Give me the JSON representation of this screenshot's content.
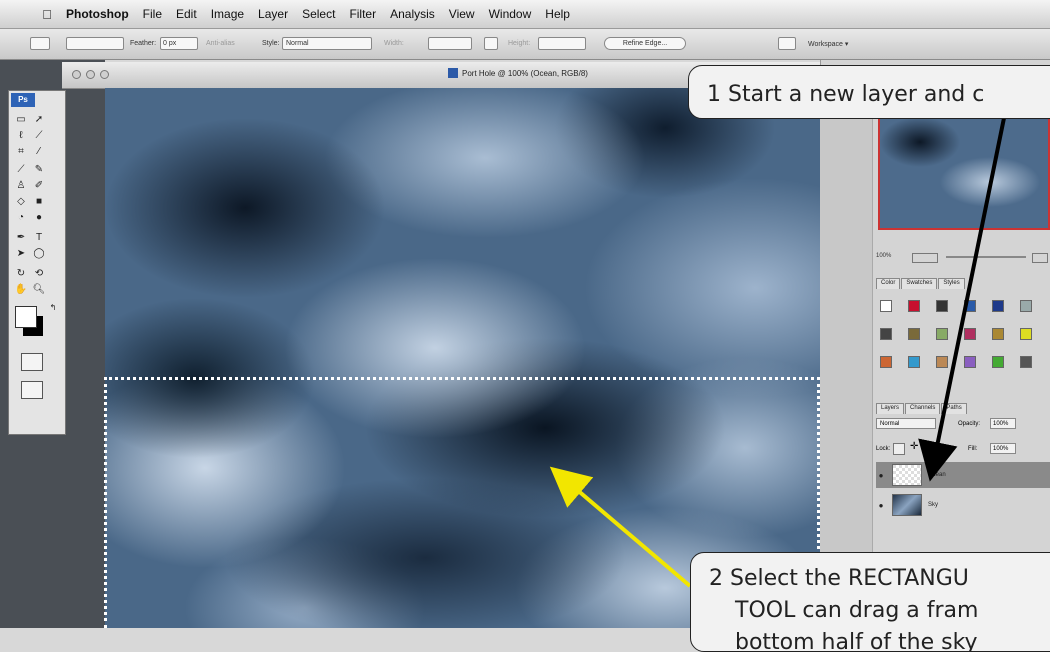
{
  "menubar": {
    "app_name": "Photoshop",
    "items": [
      "File",
      "Edit",
      "Image",
      "Layer",
      "Select",
      "Filter",
      "Analysis",
      "View",
      "Window",
      "Help"
    ]
  },
  "options_bar": {
    "feather_label": "Feather:",
    "feather_value": "0 px",
    "antialias_label": "Anti-alias",
    "style_label": "Style:",
    "style_value": "Normal",
    "width_label": "Width:",
    "height_label": "Height:",
    "refine_button": "Refine Edge...",
    "workspace_label": "Workspace"
  },
  "toolbox": {
    "logo": "Ps"
  },
  "document": {
    "title": "Port Hole @ 100% (Ocean, RGB/8)"
  },
  "navigator": {
    "zoom": "100%"
  },
  "swatches_panel": {
    "tabs": [
      "Color",
      "Swatches",
      "Styles"
    ],
    "colors": [
      "#ffffff",
      "#c8102e",
      "#333333",
      "#2a5aa8",
      "#1e3a8a",
      "#9aa",
      "#444",
      "#7a6a3a",
      "#8a6",
      "#b03060",
      "#a83",
      "#dd2",
      "#c63",
      "#39c",
      "#b85",
      "#8a5fc0",
      "#4a3",
      "#555"
    ]
  },
  "layers_panel": {
    "tabs": [
      "Layers",
      "Channels",
      "Paths"
    ],
    "blend_mode": "Normal",
    "opacity_label": "Opacity:",
    "opacity_value": "100%",
    "lock_label": "Lock:",
    "fill_label": "Fill:",
    "fill_value": "100%",
    "layers": [
      {
        "name": "Ocean",
        "selected": true
      },
      {
        "name": "Sky",
        "selected": false
      }
    ]
  },
  "callouts": {
    "one": "1  Start a new layer and c",
    "two_line1": "2  Select the RECTANGU",
    "two_line2": "TOOL can drag a fram",
    "two_line3": "bottom half of the sky"
  }
}
